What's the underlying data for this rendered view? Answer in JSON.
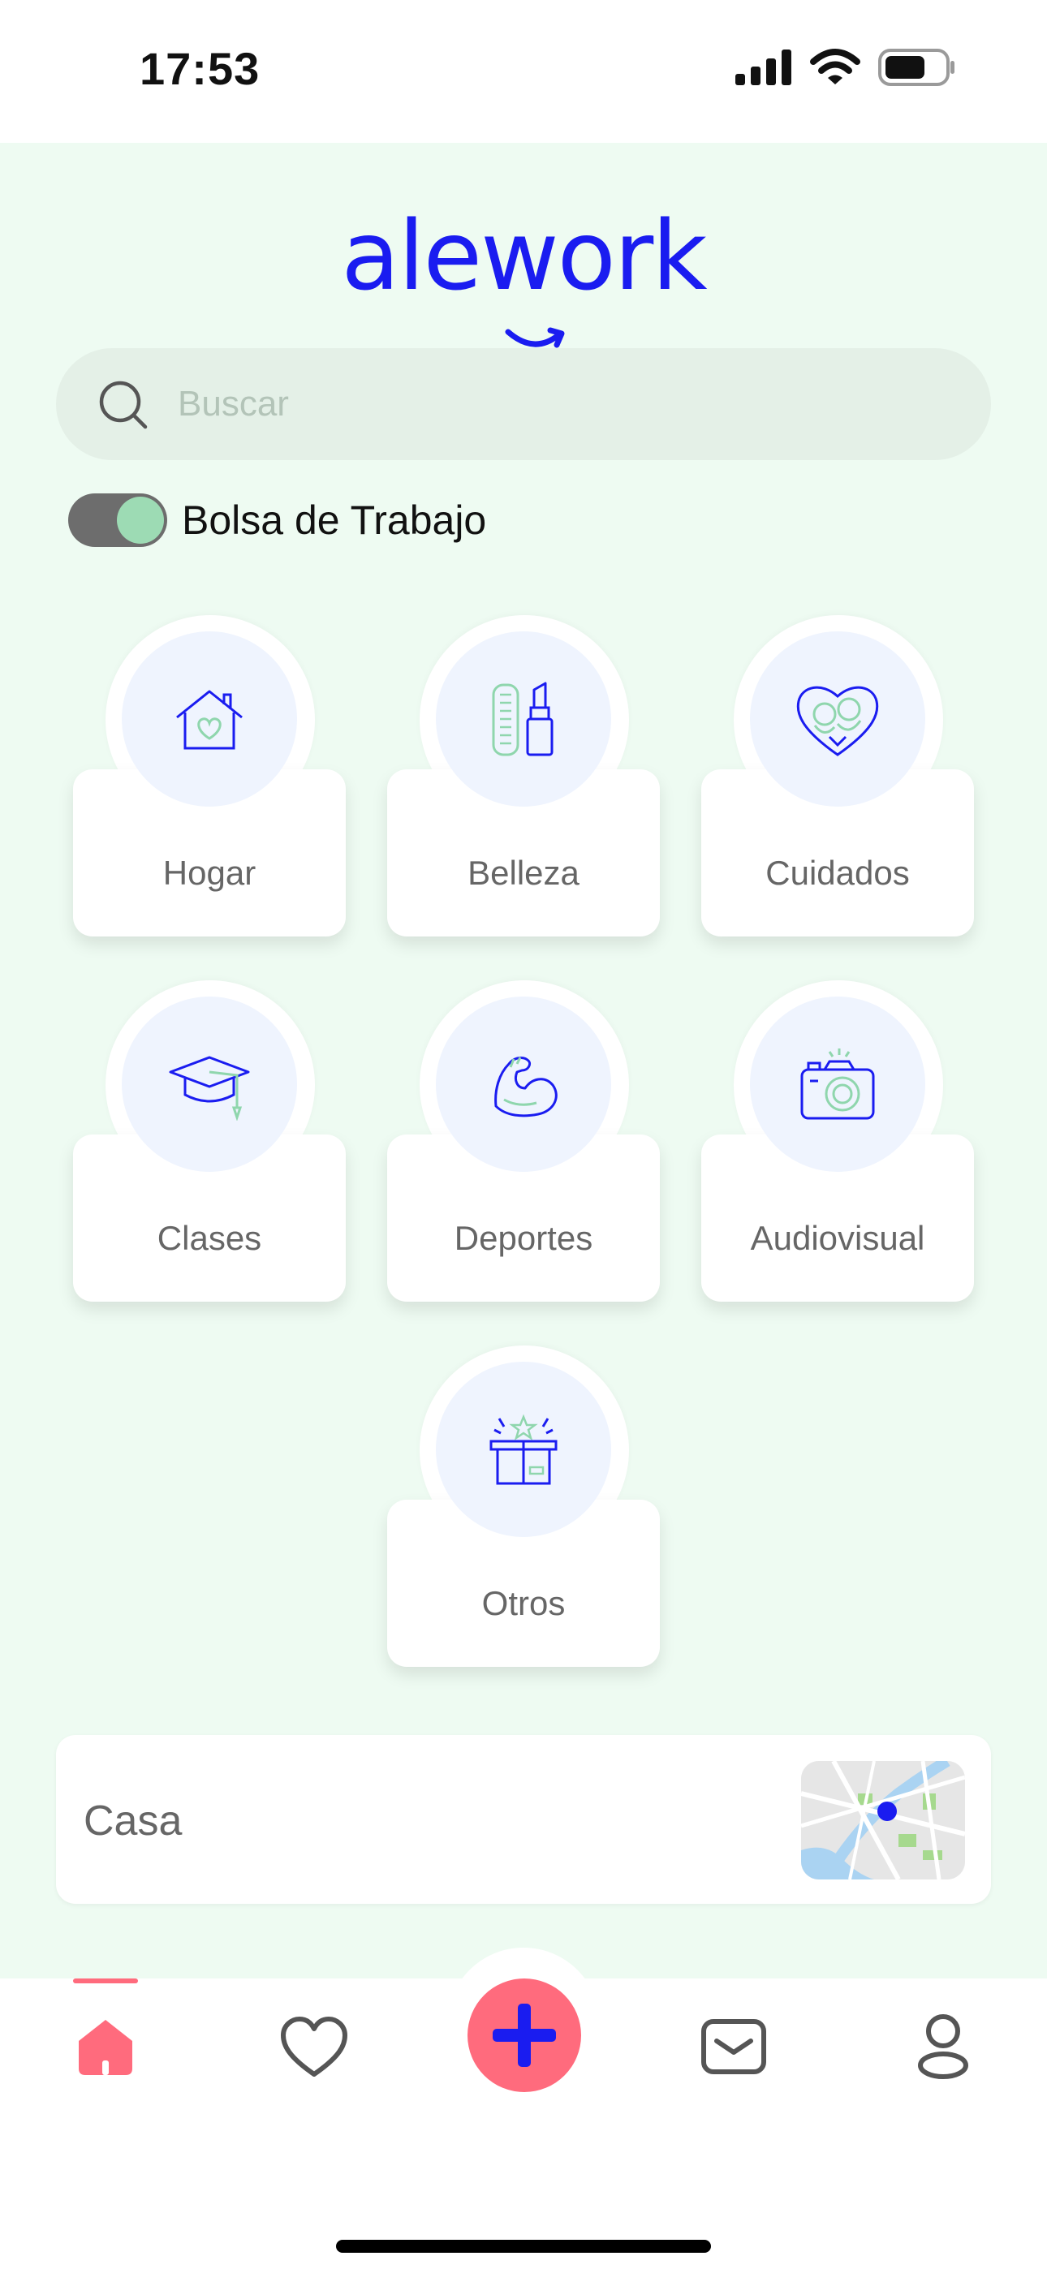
{
  "status_bar": {
    "time": "17:53"
  },
  "app": {
    "logo": "alework",
    "brand_color": "#1a1cf0",
    "accent_color": "#ff6b7d",
    "background_color": "#eefbf2"
  },
  "search": {
    "placeholder": "Buscar",
    "value": ""
  },
  "toggle": {
    "label": "Bolsa de Trabajo",
    "on": true
  },
  "categories": [
    {
      "label": "Hogar",
      "icon": "house-heart-icon"
    },
    {
      "label": "Belleza",
      "icon": "comb-lipstick-icon"
    },
    {
      "label": "Cuidados",
      "icon": "heart-family-icon"
    },
    {
      "label": "Clases",
      "icon": "graduation-cap-icon"
    },
    {
      "label": "Deportes",
      "icon": "flexed-arm-icon"
    },
    {
      "label": "Audiovisual",
      "icon": "camera-icon"
    },
    {
      "label": "Otros",
      "icon": "open-box-icon"
    }
  ],
  "location": {
    "label": "Casa",
    "icon": "map-thumbnail"
  },
  "tabbar": {
    "items": [
      {
        "name": "home",
        "icon": "home-icon",
        "active": true
      },
      {
        "name": "favorites",
        "icon": "heart-icon",
        "active": false
      },
      {
        "name": "add",
        "icon": "plus-icon",
        "active": false
      },
      {
        "name": "messages",
        "icon": "inbox-icon",
        "active": false
      },
      {
        "name": "profile",
        "icon": "user-icon",
        "active": false
      }
    ]
  }
}
